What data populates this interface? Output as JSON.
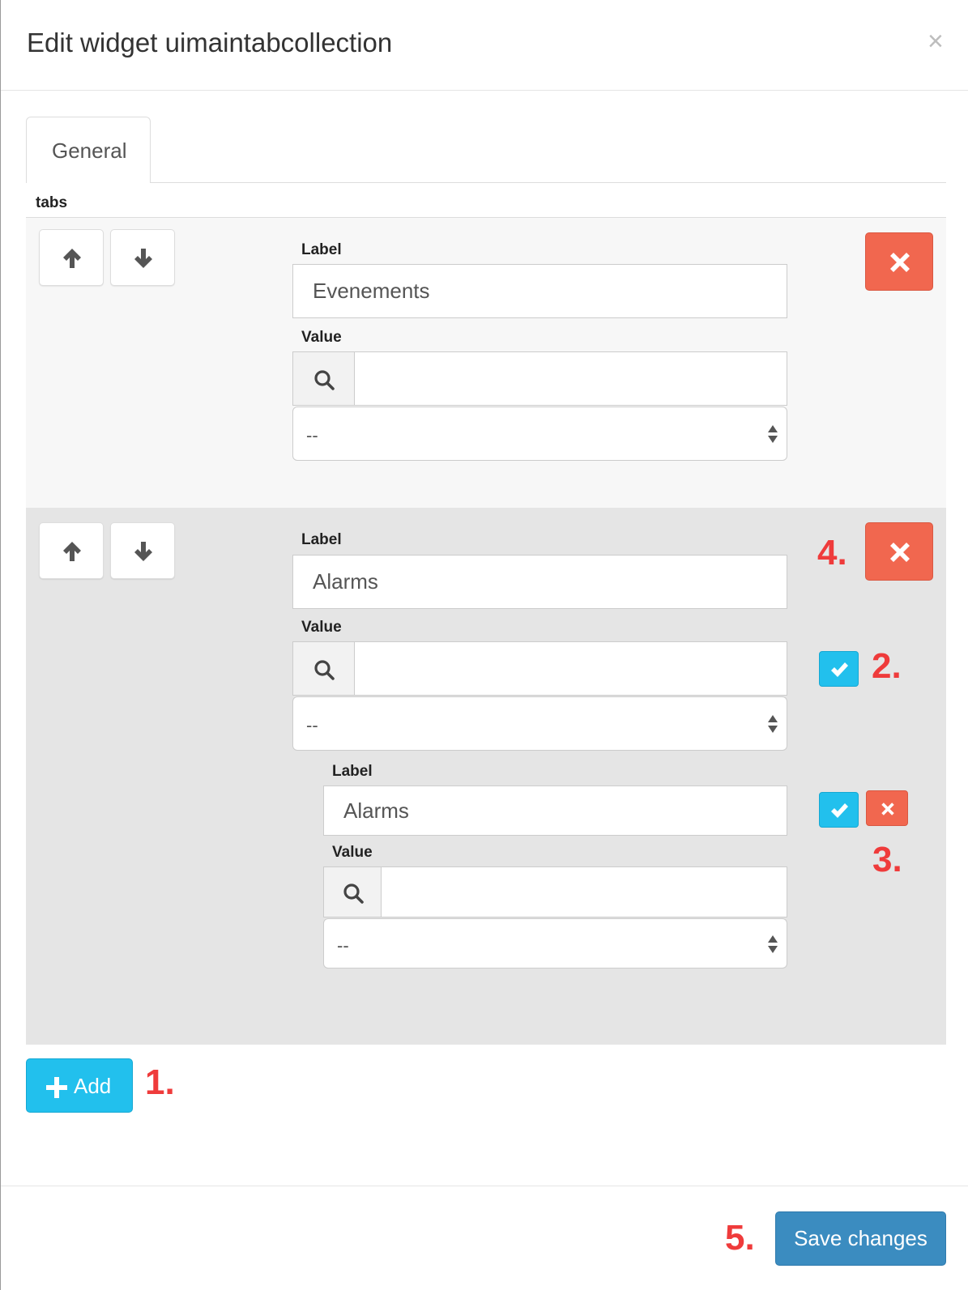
{
  "modal": {
    "title": "Edit widget uimaintabcollection",
    "close_symbol": "×"
  },
  "tabs_nav": {
    "active_tab": "General"
  },
  "section_label": "tabs",
  "items": [
    {
      "label_title": "Label",
      "label_value": "Evenements",
      "value_title": "Value",
      "value_input": "",
      "select_value": "--"
    },
    {
      "label_title": "Label",
      "label_value": "Alarms",
      "value_title": "Value",
      "value_input": "",
      "select_value": "--",
      "nested": {
        "label_title": "Label",
        "label_value": "Alarms",
        "value_title": "Value",
        "value_input": "",
        "select_value": "--"
      }
    }
  ],
  "annotations": {
    "a1": "1.",
    "a2": "2.",
    "a3": "3.",
    "a4": "4.",
    "a5": "5."
  },
  "buttons": {
    "add_label": "Add",
    "save_label": "Save changes"
  },
  "icons": {
    "up": "arrow-up-icon",
    "down": "arrow-down-icon",
    "search": "search-icon",
    "delete": "times-icon",
    "confirm": "check-icon",
    "add": "plus-icon"
  },
  "colors": {
    "danger": "#f1674f",
    "info": "#22c0ed",
    "primary": "#3b8cc0",
    "annotation": "#ef3b3b"
  }
}
